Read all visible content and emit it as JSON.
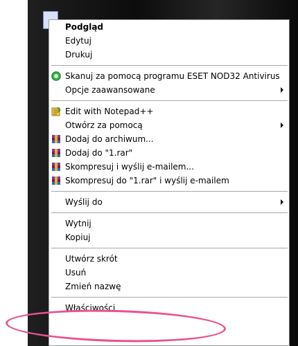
{
  "menu": {
    "items": [
      {
        "label": "Podgląd",
        "bold": true
      },
      {
        "label": "Edytuj"
      },
      {
        "label": "Drukuj"
      },
      {
        "sep": true
      },
      {
        "label": "Skanuj za pomocą programu ESET NOD32 Antivirus",
        "icon": "eset-icon"
      },
      {
        "label": "Opcje zaawansowane",
        "submenu": true
      },
      {
        "sep": true
      },
      {
        "label": "Edit with Notepad++",
        "icon": "notepad-plus-plus-icon"
      },
      {
        "label": "Otwórz za pomocą",
        "submenu": true
      },
      {
        "label": "Dodaj do archiwum...",
        "icon": "winrar-icon"
      },
      {
        "label": "Dodaj do \"1.rar\"",
        "icon": "winrar-icon"
      },
      {
        "label": "Skompresuj i wyślij e-mailem...",
        "icon": "winrar-icon"
      },
      {
        "label": "Skompresuj do \"1.rar\" i wyślij e-mailem",
        "icon": "winrar-icon"
      },
      {
        "sep": true
      },
      {
        "label": "Wyślij do",
        "submenu": true
      },
      {
        "sep": true
      },
      {
        "label": "Wytnij"
      },
      {
        "label": "Kopiuj"
      },
      {
        "sep": true
      },
      {
        "label": "Utwórz skrót"
      },
      {
        "label": "Usuń"
      },
      {
        "label": "Zmień nazwę"
      },
      {
        "sep": true
      },
      {
        "label": "Właściwości"
      }
    ]
  },
  "colors": {
    "highlight_ring": "#e8538f",
    "eset": "#3bb34a",
    "notepad": "#f2c94c",
    "winrar": "#8b1a3a"
  }
}
